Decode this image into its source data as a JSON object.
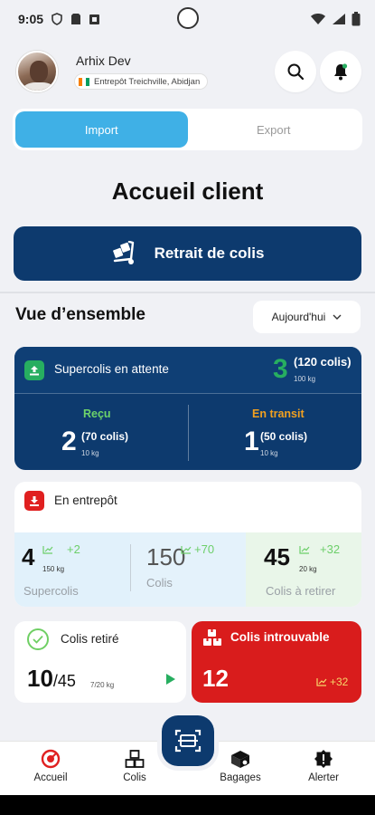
{
  "status_bar": {
    "time": "9:05"
  },
  "header": {
    "user_name": "Arhix Dev",
    "location": "Entrepôt Treichville, Abidjan"
  },
  "tabs": [
    {
      "label": "Import",
      "active": true
    },
    {
      "label": "Export",
      "active": false
    }
  ],
  "page_title": "Accueil client",
  "retrait_button_label": "Retrait de colis",
  "overview": {
    "title": "Vue d’ensemble",
    "period": "Aujourd'hui"
  },
  "supercolis": {
    "label": "Supercolis en attente",
    "count": "3",
    "colis": "(120 colis)",
    "weight": "100 kg",
    "recu": {
      "label": "Reçu",
      "count": "2",
      "colis": "(70 colis)",
      "weight": "10 kg"
    },
    "transit": {
      "label": "En transit",
      "count": "1",
      "colis": "(50 colis)",
      "weight": "10 kg"
    }
  },
  "entrepot": {
    "title": "En entrepôt",
    "stats": [
      {
        "value": "4",
        "weight": "150 kg",
        "delta": "+2",
        "label": "Supercolis"
      },
      {
        "value": "150",
        "delta": "+70",
        "label": "Colis"
      },
      {
        "value": "45",
        "weight": "20 kg",
        "delta": "+32",
        "label": "Colis à retirer"
      }
    ]
  },
  "retire": {
    "title": "Colis retiré",
    "count": "10",
    "total": "/45",
    "weight": "7/20 kg"
  },
  "introuvable": {
    "title": "Colis introuvable",
    "count": "12",
    "delta": "+32"
  },
  "nav": [
    {
      "label": "Accueil",
      "icon": "home-icon",
      "active": true
    },
    {
      "label": "Colis",
      "icon": "boxes-icon"
    },
    {
      "label": "Bagages",
      "icon": "bags-icon"
    },
    {
      "label": "Alerter",
      "icon": "alert-icon"
    }
  ],
  "colors": {
    "primary": "#0d3a6e",
    "accent": "#3fb0e6",
    "success": "#27ae60",
    "danger": "#d91c1c",
    "warning": "#f0a020"
  }
}
